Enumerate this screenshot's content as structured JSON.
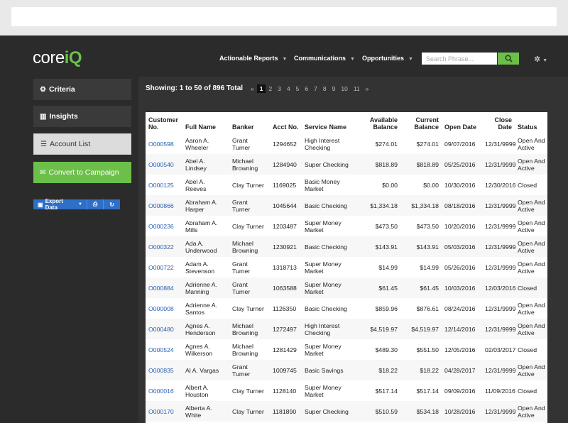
{
  "search": {
    "placeholder": "Search Phrase..."
  },
  "brand": {
    "part1": "core",
    "part2": "iQ"
  },
  "nav": [
    {
      "label": "Actionable Reports"
    },
    {
      "label": "Communications"
    },
    {
      "label": "Opportunities"
    }
  ],
  "sidebar": {
    "criteria": "Criteria",
    "insights": "Insights",
    "account_list": "Account List",
    "convert": "Convert to Campaign",
    "export": "Export Data"
  },
  "main": {
    "showing": "Showing: 1 to 50 of 896 Total",
    "pages": [
      "«",
      "1",
      "2",
      "3",
      "4",
      "5",
      "6",
      "7",
      "8",
      "9",
      "10",
      "11",
      "»"
    ],
    "current_page": "1"
  },
  "table": {
    "headers": [
      "Customer No.",
      "Full Name",
      "Banker",
      "Acct No.",
      "Service Name",
      "Available Balance",
      "Current Balance",
      "Open Date",
      "Close Date",
      "Status"
    ],
    "rows": [
      [
        "O000598",
        "Aaron A. Wheeler",
        "Grant Turner",
        "1294652",
        "High Interest Checking",
        "$274.01",
        "$274.01",
        "09/07/2016",
        "12/31/9999",
        "Open And Active"
      ],
      [
        "O000540",
        "Abel A. Lindsey",
        "Michael Browning",
        "1284940",
        "Super Checking",
        "$818.89",
        "$818.89",
        "05/25/2016",
        "12/31/9999",
        "Open And Active"
      ],
      [
        "O000125",
        "Abel A. Reeves",
        "Clay Turner",
        "1169025",
        "Basic Money Market",
        "$0.00",
        "$0.00",
        "10/30/2016",
        "12/30/2016",
        "Closed"
      ],
      [
        "O000866",
        "Abraham A. Harper",
        "Grant Turner",
        "1045644",
        "Basic Checking",
        "$1,334.18",
        "$1,334.18",
        "08/18/2016",
        "12/31/9999",
        "Open And Active"
      ],
      [
        "O000236",
        "Abraham A. Mills",
        "Clay Turner",
        "1203487",
        "Super Money Market",
        "$473.50",
        "$473.50",
        "10/20/2016",
        "12/31/9999",
        "Open And Active"
      ],
      [
        "O000322",
        "Ada A. Underwood",
        "Michael Browning",
        "1230921",
        "Basic Checking",
        "$143.91",
        "$143.91",
        "05/03/2016",
        "12/31/9999",
        "Open And Active"
      ],
      [
        "O000722",
        "Adam A. Stevenson",
        "Grant Turner",
        "1318713",
        "Super Money Market",
        "$14.99",
        "$14.99",
        "05/26/2016",
        "12/31/9999",
        "Open And Active"
      ],
      [
        "O000884",
        "Adrienne A. Manning",
        "Grant Turner",
        "1063588",
        "Super Money Market",
        "$61.45",
        "$61.45",
        "10/03/2016",
        "12/03/2016",
        "Closed"
      ],
      [
        "O000008",
        "Adrienne A. Santos",
        "Clay Turner",
        "1126350",
        "Basic Checking",
        "$859.96",
        "$876.61",
        "08/24/2016",
        "12/31/9999",
        "Open And Active"
      ],
      [
        "O000480",
        "Agnes A. Henderson",
        "Michael Browning",
        "1272497",
        "High Interest Checking",
        "$4,519.97",
        "$4,519.97",
        "12/14/2016",
        "12/31/9999",
        "Open And Active"
      ],
      [
        "O000524",
        "Agnes A. Wilkerson",
        "Michael Browning",
        "1281429",
        "Super Money Market",
        "$489.30",
        "$551.50",
        "12/05/2016",
        "02/03/2017",
        "Closed"
      ],
      [
        "O000835",
        "Al A. Vargas",
        "Grant Turner",
        "1009745",
        "Basic Savings",
        "$18.22",
        "$18.22",
        "04/28/2017",
        "12/31/9999",
        "Open And Active"
      ],
      [
        "O000016",
        "Albert A. Houston",
        "Clay Turner",
        "1128140",
        "Super Money Market",
        "$517.14",
        "$517.14",
        "09/09/2016",
        "11/09/2016",
        "Closed"
      ],
      [
        "O000170",
        "Alberta A. White",
        "Clay Turner",
        "1181890",
        "Super Checking",
        "$510.59",
        "$534.18",
        "10/28/2016",
        "12/31/9999",
        "Open And Active"
      ]
    ]
  }
}
